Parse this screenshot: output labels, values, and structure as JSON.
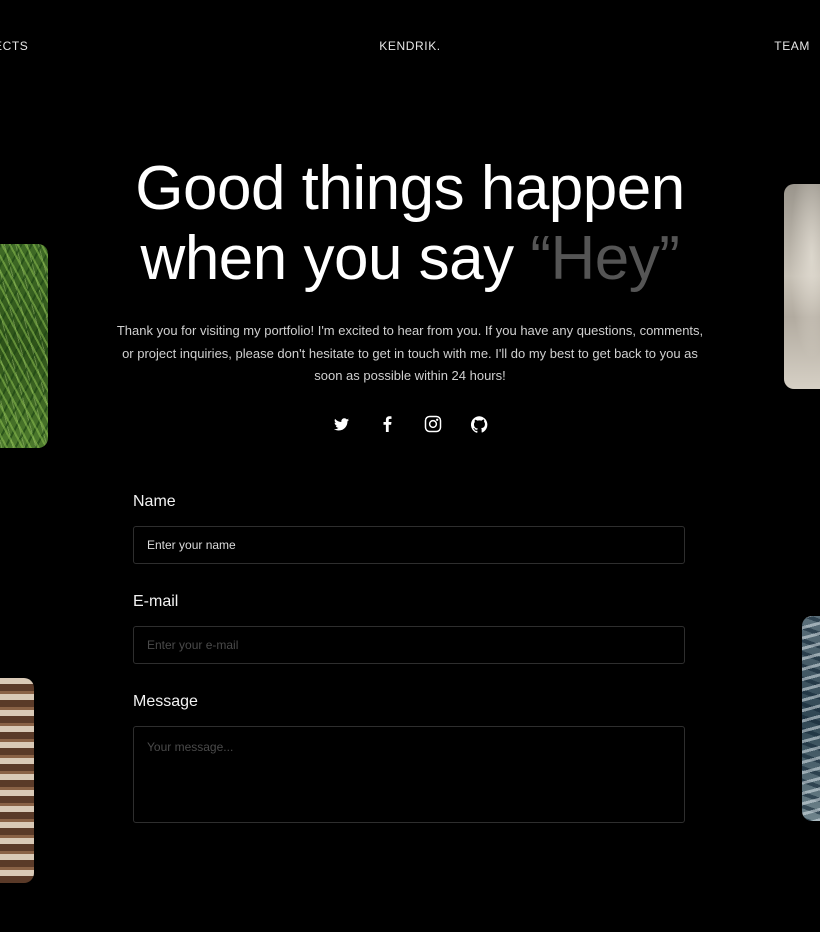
{
  "nav": {
    "left_link": "ECTS",
    "brand": "KENDRIK.",
    "right_link": "TEAM"
  },
  "hero": {
    "title_line1": "Good things happen",
    "title_line2_prefix": "when you say ",
    "title_highlight": "“Hey”"
  },
  "intro": {
    "text": "Thank you for visiting my portfolio! I'm excited to hear from you. If you have any questions, comments, or project inquiries, please don't hesitate to get in touch with me.  I'll do my best to get back to you as soon as possible within 24 hours!"
  },
  "socials": {
    "items": [
      "twitter-icon",
      "facebook-icon",
      "instagram-icon",
      "github-icon"
    ]
  },
  "form": {
    "name_label": "Name",
    "name_placeholder": "Enter your name",
    "email_label": "E-mail",
    "email_placeholder": "Enter your e-mail",
    "message_label": "Message",
    "message_placeholder": "Your message..."
  },
  "photos": [
    "grass",
    "sand",
    "stairs",
    "waves"
  ],
  "colors": {
    "background": "#000000",
    "text": "#ffffff",
    "highlight": "#555555",
    "field_border": "#2e2e2e"
  }
}
